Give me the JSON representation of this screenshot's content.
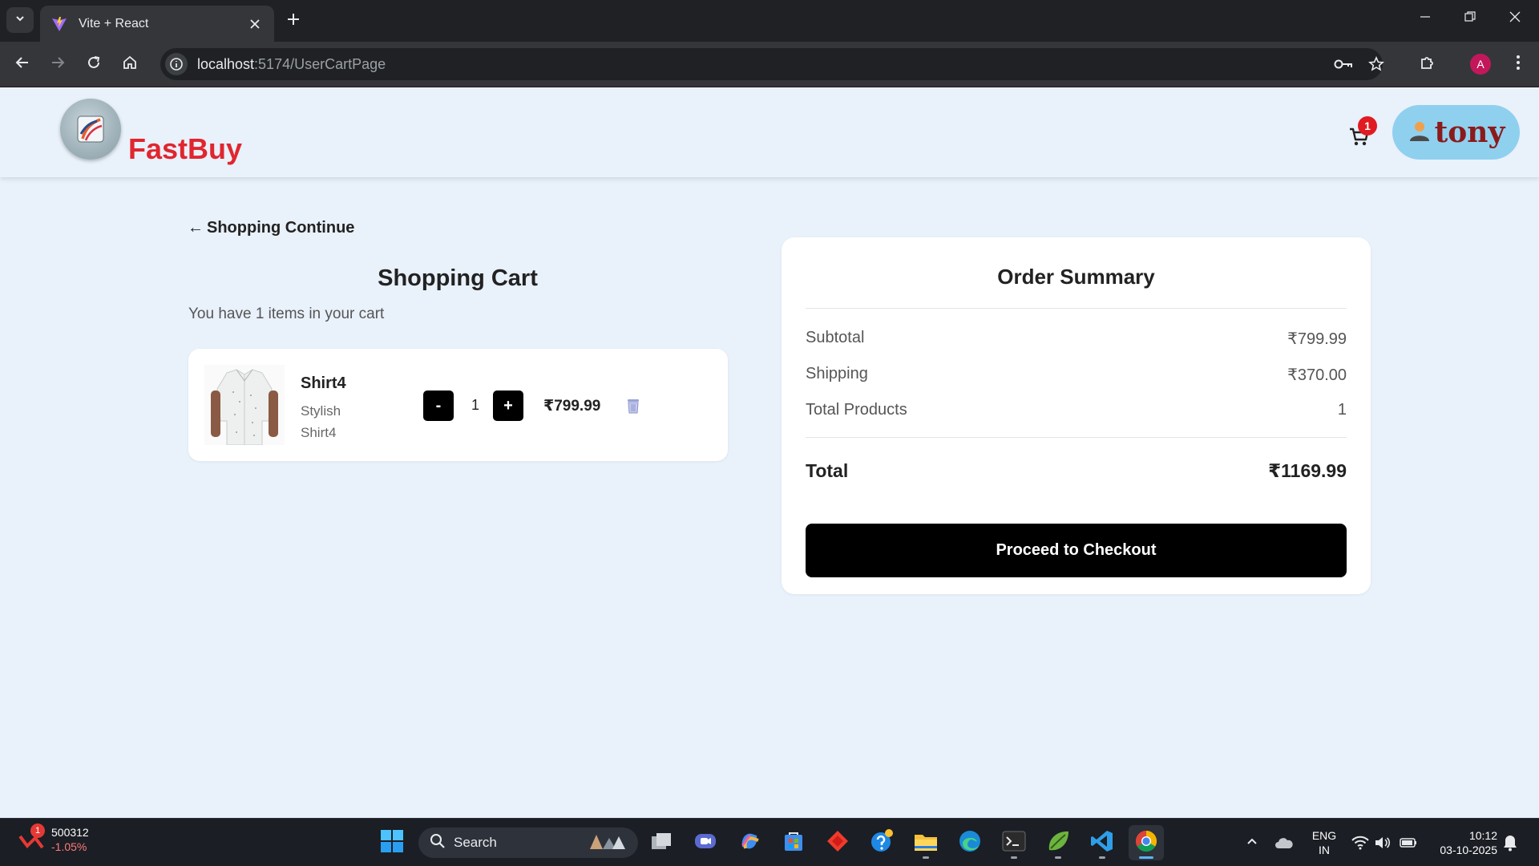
{
  "browser": {
    "tab_title": "Vite + React",
    "url_host": "localhost",
    "url_rest": ":5174/UserCartPage",
    "profile_initial": "A"
  },
  "header": {
    "brand": "FastBuy",
    "cart_count": "1",
    "user_name": "tony"
  },
  "cart": {
    "back_label": "Shopping Continue",
    "title": "Shopping Cart",
    "subtitle": "You have 1 items in your cart",
    "items": [
      {
        "name": "Shirt4",
        "description": "Stylish Shirt4",
        "minus_label": "-",
        "quantity": "1",
        "plus_label": "+",
        "price": "₹799.99"
      }
    ]
  },
  "summary": {
    "title": "Order Summary",
    "subtotal_label": "Subtotal",
    "subtotal_value": "₹799.99",
    "shipping_label": "Shipping",
    "shipping_value": "₹370.00",
    "products_label": "Total Products",
    "products_value": "1",
    "total_label": "Total",
    "total_value": "₹1169.99",
    "checkout_label": "Proceed to Checkout"
  },
  "taskbar": {
    "stock_badge": "1",
    "stock_value": "500312",
    "stock_change": "-1.05%",
    "search_label": "Search",
    "lang_top": "ENG",
    "lang_bottom": "IN",
    "time": "10:12",
    "date": "03-10-2025"
  },
  "colors": {
    "brand_red": "#e0262e",
    "page_bg": "#e9f1fb",
    "user_pill": "#8fd0ef",
    "checkout_bg": "#000000"
  }
}
